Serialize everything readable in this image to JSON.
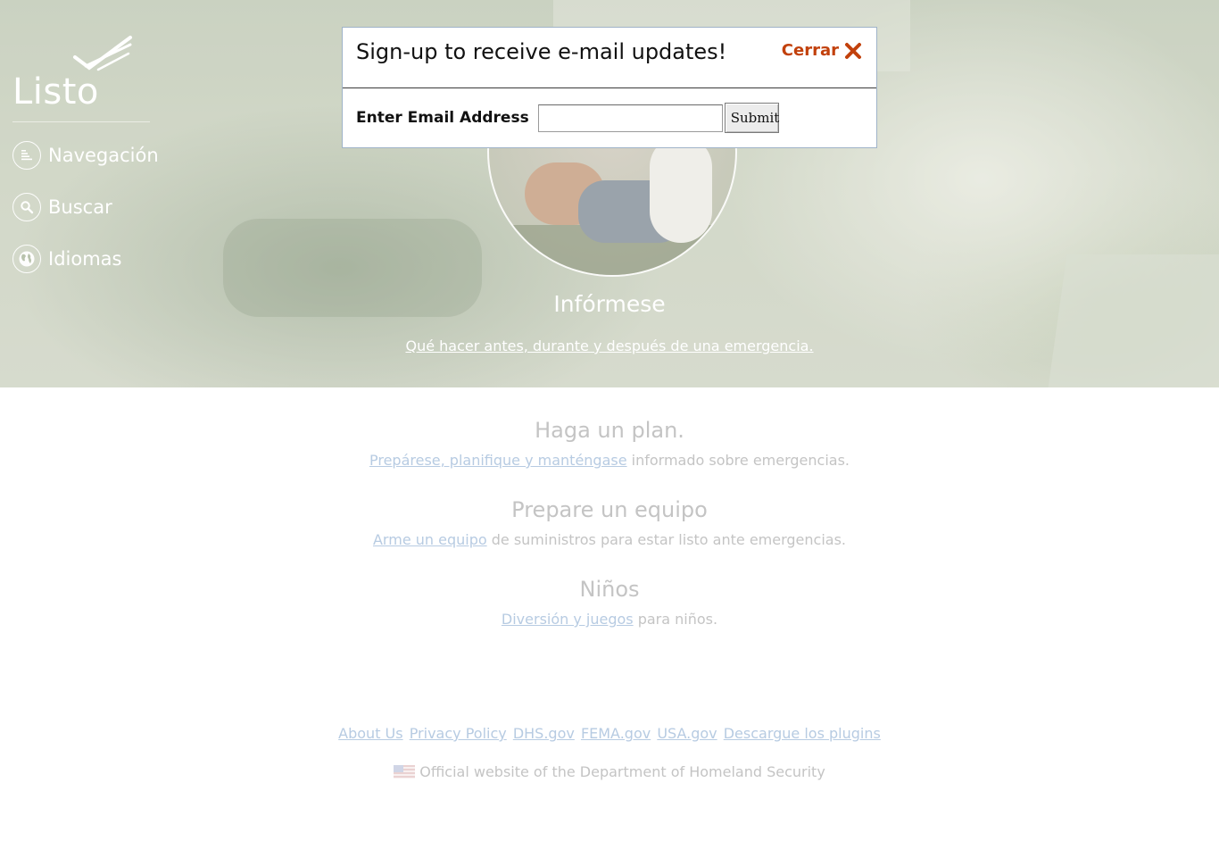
{
  "brand": {
    "logo_text": "Listo"
  },
  "nav": {
    "items": [
      {
        "label": "Navegación",
        "icon": "menu-list-icon"
      },
      {
        "label": "Buscar",
        "icon": "search-icon"
      },
      {
        "label": "Idiomas",
        "icon": "globe-icon"
      }
    ]
  },
  "hero": {
    "title": "Infórmese",
    "link": " Qué hacer antes, durante y después de una emergencia."
  },
  "sections": [
    {
      "title": "Haga un plan.",
      "link": "Prepárese, planifique y manténgase",
      "text": " informado sobre emergencias."
    },
    {
      "title": "Prepare un equipo",
      "link": "Arme un equipo",
      "text": " de suministros para estar listo ante emergencias."
    },
    {
      "title": "Niños",
      "link": "Diversión y juegos",
      "text": " para niños."
    }
  ],
  "footer": {
    "links": [
      "About Us",
      "Privacy Policy",
      "DHS.gov",
      "FEMA.gov",
      "USA.gov",
      "Descargue los plugins"
    ],
    "official": "Official website of the Department of Homeland Security"
  },
  "modal": {
    "title": "Sign-up to receive e-mail updates!",
    "close_label": "Cerrar",
    "email_label": "Enter Email Address",
    "email_value": "",
    "submit_label": "Submit"
  },
  "colors": {
    "close_accent": "#c2410c",
    "link": "#b7cbe2",
    "faded_text": "#c4c4c4"
  }
}
